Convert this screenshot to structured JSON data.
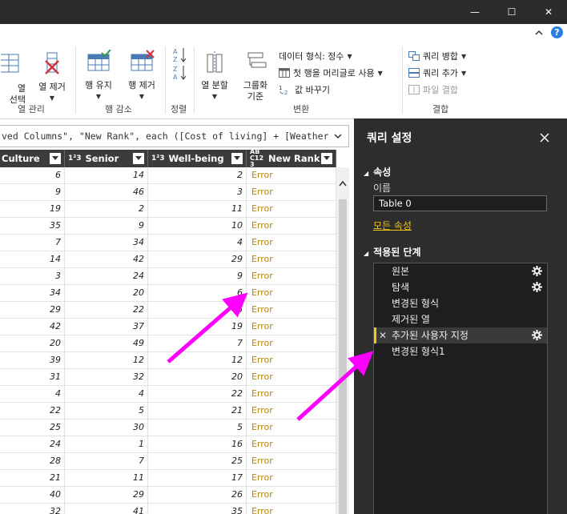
{
  "window": {
    "minimize_glyph": "—",
    "maximize_glyph": "☐",
    "close_glyph": "✕",
    "help_glyph": "?"
  },
  "ribbon": {
    "manage_columns": {
      "choose_label": "열\n선택",
      "remove_label": "열 제거",
      "group_label": "열 관리"
    },
    "reduce_rows": {
      "keep_label": "행 유지",
      "remove_label": "행 제거",
      "group_label": "행 감소"
    },
    "sort": {
      "group_label": "정렬"
    },
    "transform": {
      "split_label": "열 분할",
      "groupby_label": "그룹화\n기준",
      "datatype_label": "데이터 형식: 정수",
      "first_row_label": "첫 행을 머리글로 사용",
      "replace_label": "값 바꾸기",
      "group_label": "변환"
    },
    "combine": {
      "merge_label": "쿼리 병합",
      "append_label": "쿼리 추가",
      "combine_files_label": "파일 결합",
      "group_label": "결합"
    }
  },
  "formula": {
    "text": "ved Columns\", \"New Rank\", each ([Cost of living] + [Weather]"
  },
  "grid": {
    "columns": [
      {
        "name": "Culture",
        "type": ""
      },
      {
        "name": "Senior",
        "type": "1²3"
      },
      {
        "name": "Well-being",
        "type": "1²3"
      },
      {
        "name": "New Rank",
        "type": "ABC123"
      }
    ],
    "rows": [
      [
        "6",
        "14",
        "2",
        "Error"
      ],
      [
        "9",
        "46",
        "3",
        "Error"
      ],
      [
        "19",
        "2",
        "11",
        "Error"
      ],
      [
        "35",
        "9",
        "10",
        "Error"
      ],
      [
        "7",
        "34",
        "4",
        "Error"
      ],
      [
        "14",
        "42",
        "29",
        "Error"
      ],
      [
        "3",
        "24",
        "9",
        "Error"
      ],
      [
        "34",
        "20",
        "6",
        "Error"
      ],
      [
        "29",
        "22",
        "6",
        "Error"
      ],
      [
        "42",
        "37",
        "19",
        "Error"
      ],
      [
        "20",
        "49",
        "7",
        "Error"
      ],
      [
        "39",
        "12",
        "12",
        "Error"
      ],
      [
        "31",
        "32",
        "20",
        "Error"
      ],
      [
        "4",
        "4",
        "22",
        "Error"
      ],
      [
        "22",
        "5",
        "21",
        "Error"
      ],
      [
        "25",
        "30",
        "5",
        "Error"
      ],
      [
        "24",
        "1",
        "16",
        "Error"
      ],
      [
        "28",
        "7",
        "25",
        "Error"
      ],
      [
        "21",
        "11",
        "17",
        "Error"
      ],
      [
        "40",
        "29",
        "26",
        "Error"
      ],
      [
        "32",
        "41",
        "35",
        "Error"
      ]
    ]
  },
  "query_settings": {
    "title": "쿼리 설정",
    "properties_label": "속성",
    "name_label": "이름",
    "name_value": "Table 0",
    "all_properties_link": "모든 속성",
    "applied_steps_label": "적용된 단계",
    "steps": [
      {
        "label": "원본",
        "gear": true
      },
      {
        "label": "탐색",
        "gear": true
      },
      {
        "label": "변경된 형식",
        "gear": false
      },
      {
        "label": "제거된 열",
        "gear": false
      },
      {
        "label": "추가된 사용자 지정",
        "gear": true
      },
      {
        "label": "변경된 형식1",
        "gear": false
      }
    ],
    "selected_step": 4
  },
  "colors": {
    "error": "#b8860b",
    "accent": "#f2c811",
    "arrow": "#ff00ff",
    "pane_bg": "#2d2d2d"
  }
}
